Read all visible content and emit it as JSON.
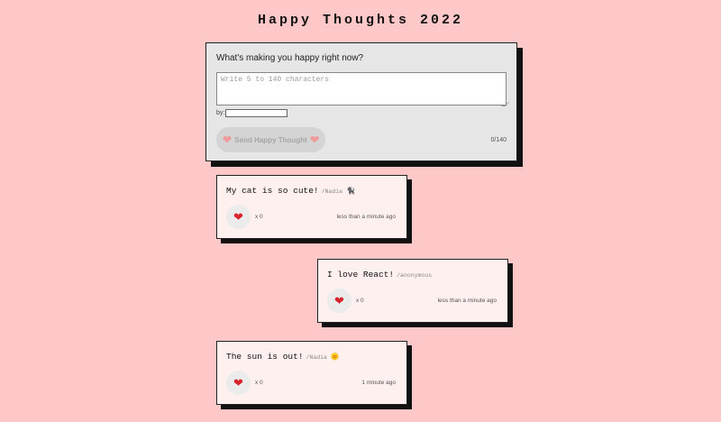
{
  "page": {
    "title": "Happy Thoughts 2022"
  },
  "form": {
    "question": "What's making you happy right now?",
    "textarea_placeholder": "Write 5 to 140 characters",
    "textarea_value": "",
    "by_label": "by:",
    "name_value": "",
    "send_label": "Send Happy Thought",
    "send_icon": "heart-icon",
    "char_count": "0/140"
  },
  "thoughts": [
    {
      "message": "My cat is so cute!",
      "author": "/Nadia",
      "emoji": "🐈‍⬛",
      "likes": "x 0",
      "time": "less than a minute ago"
    },
    {
      "message": "I love React!",
      "author": "/anonymous",
      "emoji": "",
      "likes": "x 0",
      "time": "less than a minute ago"
    },
    {
      "message": "The sun is out!",
      "author": "/Nadia",
      "emoji": "🌞",
      "likes": "x 0",
      "time": "1 minute ago"
    }
  ],
  "colors": {
    "background": "#ffc8c8",
    "form_background": "#e6e6e6",
    "card_background": "#fff0f0",
    "heart": "#d9232b",
    "shadow": "#111111"
  }
}
